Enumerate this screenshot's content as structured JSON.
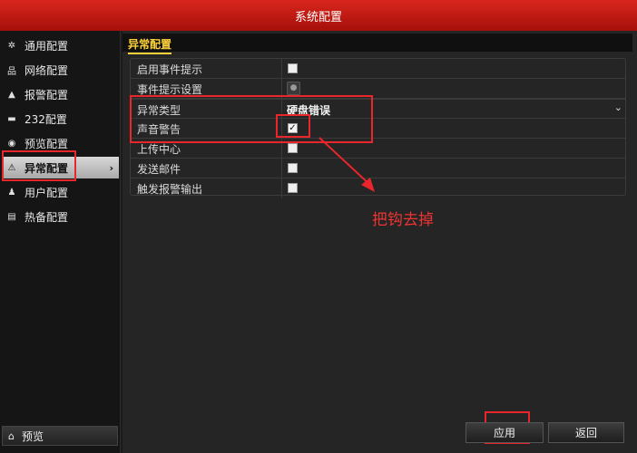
{
  "window": {
    "title": "系统配置"
  },
  "sidebar": {
    "items": [
      {
        "label": "通用配置",
        "icon": "gear-icon"
      },
      {
        "label": "网络配置",
        "icon": "network-icon"
      },
      {
        "label": "报警配置",
        "icon": "alarm-icon"
      },
      {
        "label": "232配置",
        "icon": "serial-port-icon"
      },
      {
        "label": "预览配置",
        "icon": "eye-icon"
      },
      {
        "label": "异常配置",
        "icon": "warning-icon",
        "active": true
      },
      {
        "label": "用户配置",
        "icon": "users-icon"
      },
      {
        "label": "热备配置",
        "icon": "hotspare-icon"
      }
    ],
    "preview_button": "预览"
  },
  "main": {
    "section_title": "异常配置",
    "rows": {
      "enable_hint": {
        "label": "启用事件提示",
        "checked": false
      },
      "hint_settings": {
        "label": "事件提示设置"
      },
      "exception_type": {
        "label": "异常类型",
        "value": "硬盘错误"
      },
      "sound_alarm": {
        "label": "声音警告",
        "checked": true
      },
      "upload_center": {
        "label": "上传中心",
        "checked": false
      },
      "send_email": {
        "label": "发送邮件",
        "checked": false
      },
      "trigger_output": {
        "label": "触发报警输出",
        "checked": false
      }
    }
  },
  "annotation": {
    "text": "把钩去掉",
    "color": "#ee3333"
  },
  "footer": {
    "apply": "应用",
    "back": "返回"
  },
  "colors": {
    "titlebar": "#c81a14",
    "accent": "#ffd23a",
    "highlight": "#e8262b"
  }
}
